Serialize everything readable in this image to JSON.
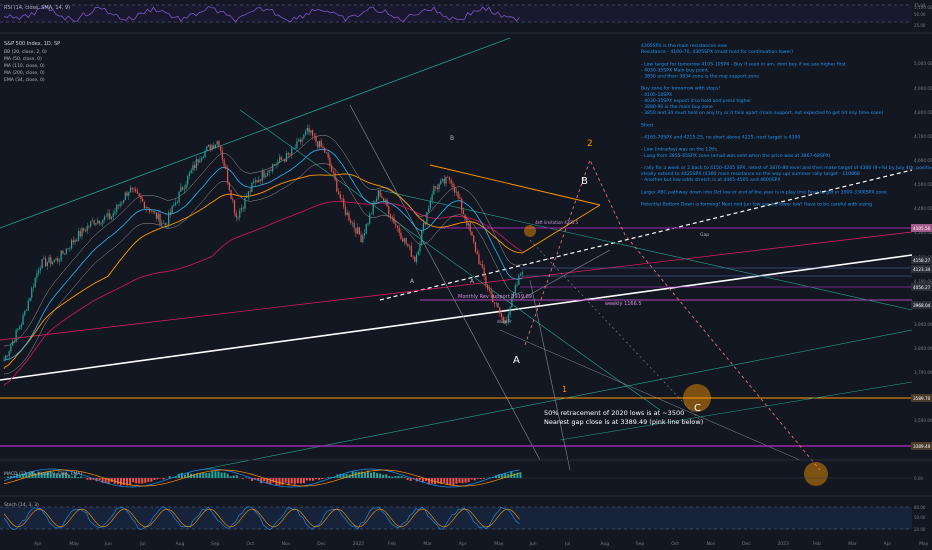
{
  "symbol_title": "S&P 500 Index, 1D, SP",
  "indicator_labels": [
    "BB (20, close, 2, 0)",
    "MA (50, close, 0)",
    "MA (110, close, 0)",
    "MA (200, close, 0)",
    "EMA (34, close, 0)"
  ],
  "rsi_label": "RSI (14, close, SMA, 14, 9)",
  "macd_label": "MACD (12, 26, close, 9, EMA, EMA)",
  "stoch_label": "Stoch (14, 3, 3)",
  "notes": [
    "4305SPX is the main resistances now",
    "Resistance - 4160-70, 4305SPX (must hold for continuation lower)",
    "",
    "- Low target for tomorrow 4105-10SPX - Buy if seen in am, dont buy if we see higher first",
    "- 4030-35SPX Main buy point.",
    "- 3850 and then 3834 zone is the maj support zone",
    "",
    "Buy zone for tomorrow with stops!",
    "- 4105-10SPX",
    "- 4030-35SPX expect it to hold and press higher",
    "- 3880-90 is the main buy zone",
    "- 3850 and 34 must hold on any try or it fails apart (main support, not expected to get hit any time soon)",
    "",
    "Short",
    "",
    "- 4165-70SPX and 4215-25, no short above 4225, next target is 4300",
    "",
    "- Low (intraday) was on the 12th;",
    "- Long from 3855-65SPX zone (email was sent when the price was at 3867-68SPX)",
    "",
    "- rally for a week or 2 back to 4150-4205 SPX, retest of 3870-80 level and then make target  of 4300 (9+%) by July 4th, positive",
    "  ideally extend to 4425SPX (4300 main resistance on the way up) summer rally target - 110868",
    "- Another but low odds stretch is at 4465-4505 and 4600SPX",
    "",
    "Larger ABC pathway down into Oct low or end of the year is in play (me Final target in 3000-3300SPX zone",
    "",
    "Potential Bottom Down is forming! Next mid Jun low can be lower low! Have to be careful with sizing"
  ],
  "annotation_lines": [
    "50% retracement of 2020 lows is at ~3500",
    "Nearest gap close is at 3389.49 (pink line below)"
  ],
  "wave_labels": {
    "A": "A",
    "B": "B",
    "C": "C",
    "two": "2",
    "one": "1",
    "A_small1": "A",
    "A_small2": "A",
    "B_small": "B"
  },
  "level_labels": {
    "monthly": "Monthly Rev support 3919.89",
    "weekly": "weekly 1166.5",
    "short_label": "4kft limitation 4305.5",
    "gap": "Gap",
    "daily_sup": "daily Pr"
  },
  "price_axis": [
    "5,100.00",
    "5,000.00",
    "4,900.00",
    "4,800.00",
    "4,700.00",
    "4,600.00",
    "4,500.00",
    "4,400.00",
    "4,300.00",
    "4,200.00",
    "4,100.00",
    "4,000.00",
    "3,900.00",
    "3,800.00",
    "3,700.00",
    "3,600.00",
    "3,500.00",
    "3,400.00",
    "3,300.00",
    "3,200.00"
  ],
  "price_badges": [
    {
      "text": "4305.56",
      "color": "#a35b8a"
    },
    {
      "text": "4158.27",
      "color": "#2c2f3a"
    },
    {
      "text": "4123.34",
      "color": "#2c2f3a"
    },
    {
      "text": "4056.27",
      "color": "#2c2f3a"
    },
    {
      "text": "3968.04",
      "color": "#2c2f3a"
    },
    {
      "text": "3589.70",
      "color": "#4a3a2c"
    },
    {
      "text": "3389.49",
      "color": "#4a3a2c"
    }
  ],
  "rsi_axis": [
    "75.00",
    "50.00",
    "25.00"
  ],
  "macd_axis": [
    "0.00"
  ],
  "stoch_axis": [
    "80.00",
    "50.00",
    "20.00"
  ],
  "time_axis": [
    "Apr",
    "May",
    "Jun",
    "Jul",
    "Aug",
    "Sep",
    "Oct",
    "Nov",
    "Dec",
    "2022",
    "Feb",
    "Mar",
    "Apr",
    "May",
    "Jun",
    "Jul",
    "Aug",
    "Sep",
    "Oct",
    "Nov",
    "Dec",
    "2023",
    "Feb",
    "Mar",
    "Apr",
    "May"
  ],
  "colors": {
    "background": "#131722",
    "notes_text": "#2196f3",
    "up": "#26a69a",
    "down": "#ef5350",
    "orange": "#ff9800",
    "purple": "#9c27b0",
    "white": "#ffffff"
  },
  "chart_data": {
    "type": "line",
    "title": "S&P 500 Index, 1D, SP",
    "ylim": [
      3200,
      5100
    ],
    "x_labels": [
      "Apr",
      "May",
      "Jun",
      "Jul",
      "Aug",
      "Sep",
      "Oct",
      "Nov",
      "Dec",
      "2022",
      "Feb",
      "Mar",
      "Apr",
      "May",
      "Jun"
    ],
    "series": [
      {
        "name": "S&P 500 Index",
        "values": [
          3730,
          3910,
          4180,
          4200,
          4300,
          4380,
          4400,
          4530,
          4450,
          4360,
          4540,
          4690,
          4760,
          4400,
          4560,
          4640,
          4690,
          4800,
          4700,
          4440,
          4300,
          4520,
          4350,
          4200,
          4530,
          4580,
          4350,
          4080,
          3900,
          4160
        ]
      }
    ]
  }
}
